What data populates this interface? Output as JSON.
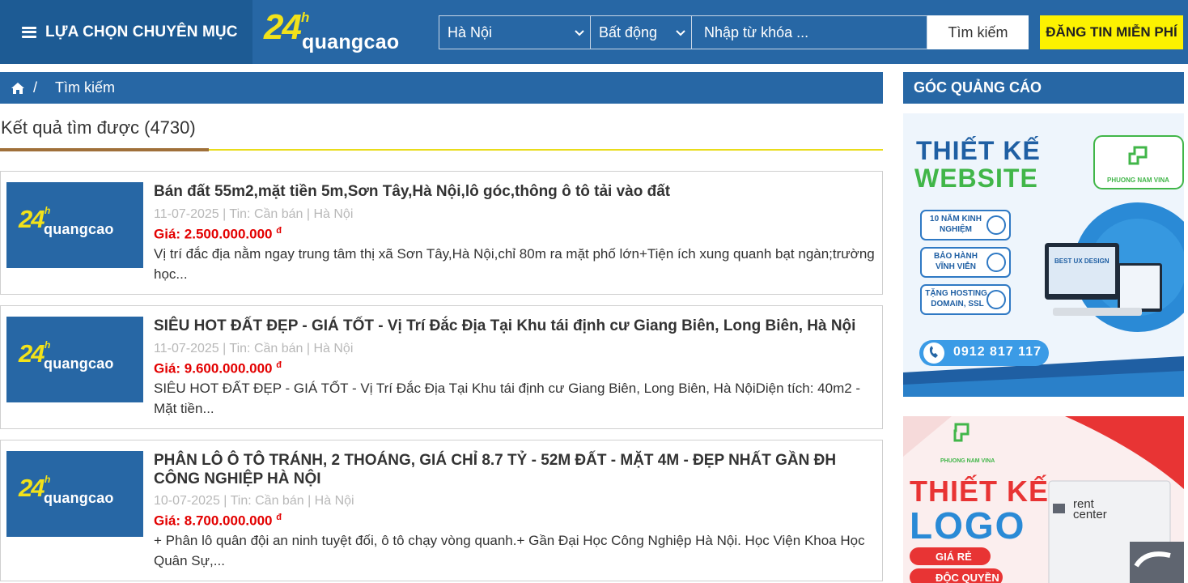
{
  "header": {
    "menu_label": "LỰA CHỌN CHUYÊN MỤC",
    "logo_num": "24",
    "logo_h": "h",
    "logo_text": "quangcao",
    "city_select": "Hà Nội",
    "category_select": "Bất động",
    "search_placeholder": "Nhập từ khóa ...",
    "search_button": "Tìm kiếm",
    "post_button": "ĐĂNG TIN MIỄN PHÍ"
  },
  "breadcrumb": {
    "sep": "/",
    "current": "Tìm kiếm"
  },
  "results": {
    "title": "Kết quả tìm được (4730)"
  },
  "listings": [
    {
      "title": "Bán đất 55m2,mặt tiền 5m,Sơn Tây,Hà Nội,lô góc,thông ô tô tải vào đất",
      "meta": "11-07-2025 | Tin: Cần bán | Hà Nội",
      "price": "Giá: 2.500.000.000",
      "currency": "đ",
      "desc": "Vị trí đắc địa nằm ngay trung tâm thị xã Sơn Tây,Hà Nội,chỉ 80m ra mặt phố lớn+Tiện ích xung quanh bạt ngàn;trường học..."
    },
    {
      "title": "SIÊU HOT ĐẤT ĐẸP - GIÁ TỐT - Vị Trí Đắc Địa Tại Khu tái định cư Giang Biên, Long Biên, Hà Nội",
      "meta": "11-07-2025 | Tin: Cần bán | Hà Nội",
      "price": "Giá: 9.600.000.000",
      "currency": "đ",
      "desc": "SIÊU HOT ĐẤT ĐẸP - GIÁ TỐT - Vị Trí Đắc Địa Tại Khu tái định cư Giang Biên, Long Biên, Hà NộiDiện tích: 40m2 - Mặt tiền..."
    },
    {
      "title": "PHÂN LÔ Ô TÔ TRÁNH, 2 THOÁNG, GIÁ CHỈ 8.7 TỶ - 52M ĐẤT - MẶT 4M - ĐẸP NHẤT GẦN ĐH CÔNG NGHIỆP HÀ NỘI",
      "meta": "10-07-2025 | Tin: Cần bán | Hà Nội",
      "price": "Giá: 8.700.000.000",
      "currency": "đ",
      "desc": "+ Phân lô quân đội an ninh tuyệt đối, ô tô chạy vòng quanh.+ Gần Đại Học Công Nghiệp Hà Nội. Học Viện Khoa Học Quân Sự,..."
    }
  ],
  "sidebar": {
    "title": "GÓC QUẢNG CÁO",
    "ad1": {
      "headline1": "THIẾT KẾ",
      "headline2": "WEBSITE",
      "brand": "PHUONG NAM VINA",
      "feature1": "10 NĂM KINH NGHIỆM",
      "feature2": "BẢO HÀNH VĨNH VIỄN",
      "feature3": "TẶNG HOSTING, DOMAIN, SSL",
      "phone": "0912 817 117",
      "screen_text": "BEST UX DESIGN"
    },
    "ad2": {
      "brand": "PHUONG NAM VINA",
      "headline1": "THIẾT KẾ",
      "headline2": "LOGO",
      "tag1": "GIÁ RẺ",
      "tag2": "ĐỘC QUYỀN",
      "mock_brand1": "rent",
      "mock_brand2": "center"
    }
  },
  "colors": {
    "primary": "#2767a5",
    "accent_yellow": "#fcf200",
    "price_red": "#e30000"
  }
}
